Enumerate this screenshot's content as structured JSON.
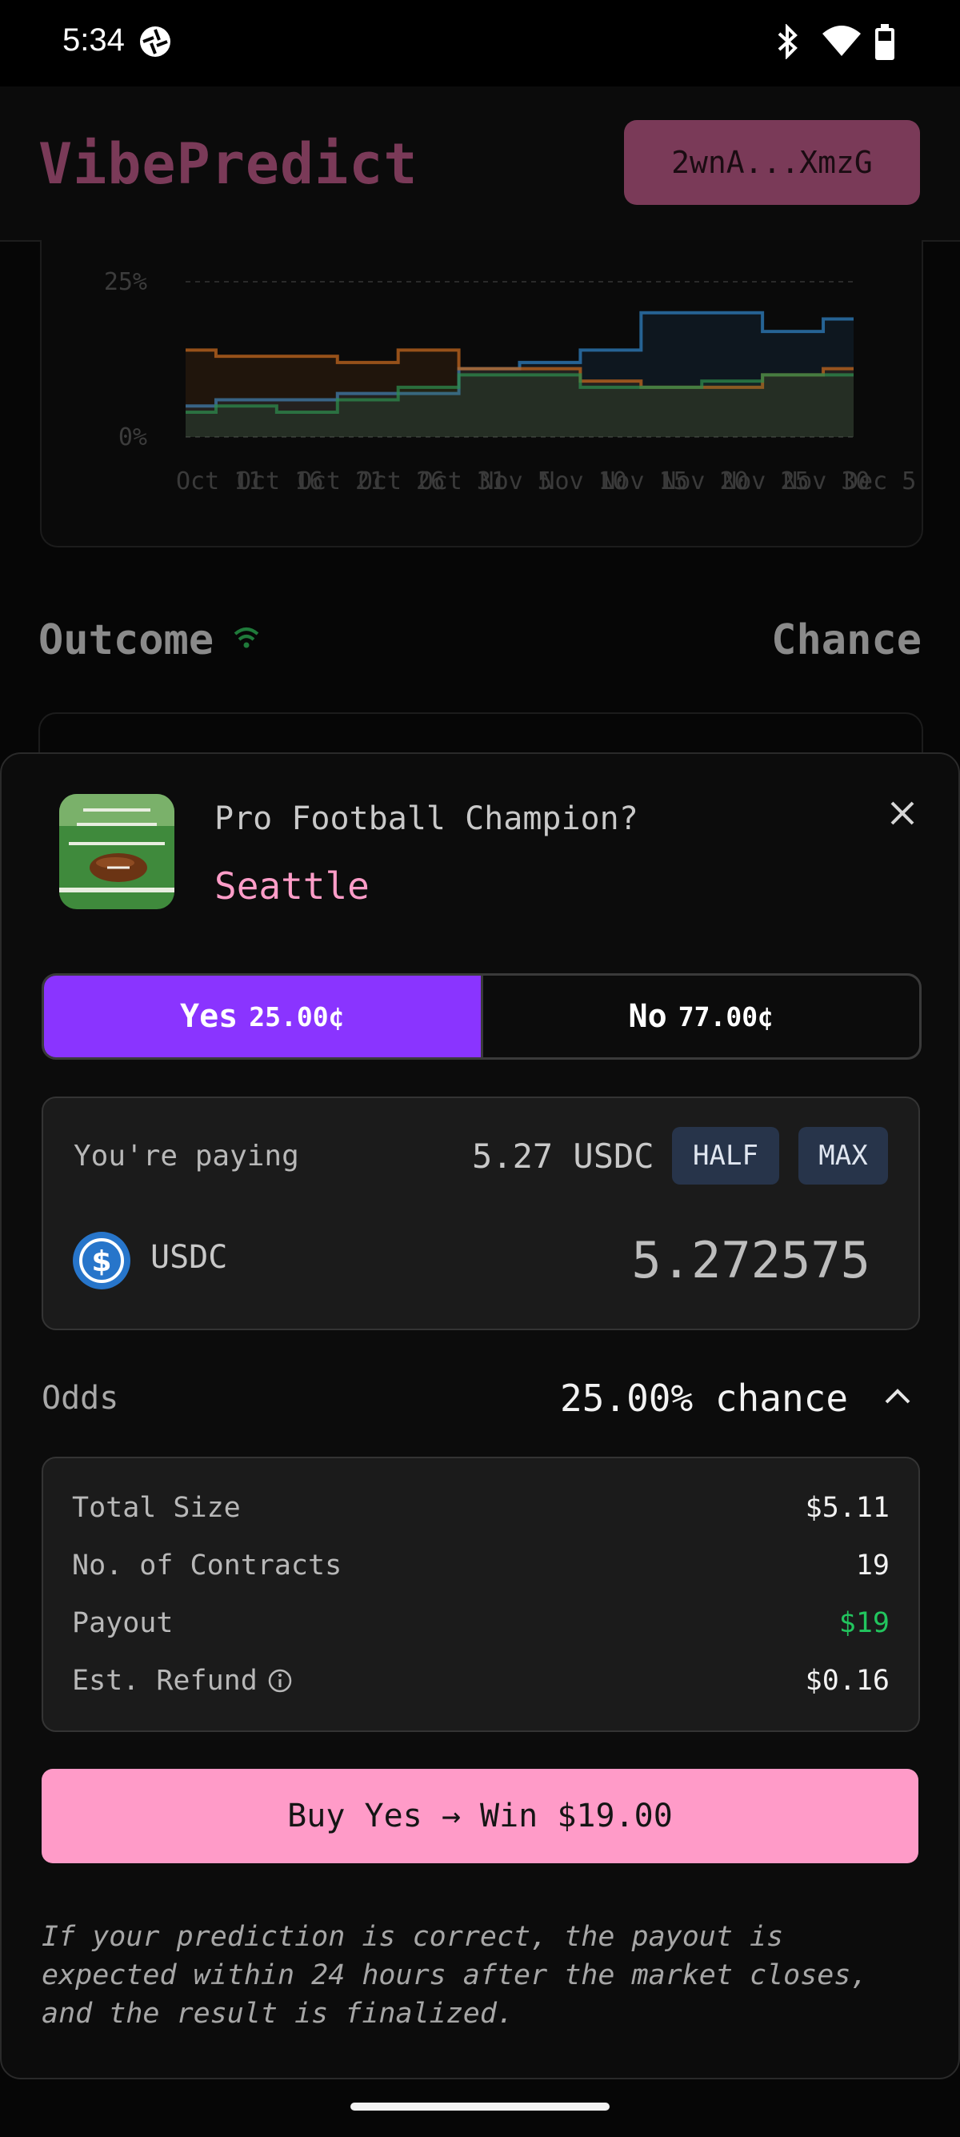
{
  "status_bar": {
    "time": "5:34"
  },
  "header": {
    "brand": "VibePredict",
    "wallet": "2wnA...XmzG"
  },
  "chart_data": {
    "type": "line",
    "x": [
      "Oct 11",
      "Oct 16",
      "Oct 21",
      "Oct 26",
      "Oct 31",
      "Nov 5",
      "Nov 10",
      "Nov 15",
      "Nov 20",
      "Nov 25",
      "Nov 30",
      "Dec 5"
    ],
    "y_ticks": [
      "25%",
      "0%"
    ],
    "ylim": [
      0,
      25
    ],
    "grid": true,
    "series": [
      {
        "color": "#2f7fbf",
        "values": [
          5,
          6,
          6,
          7,
          7,
          11,
          12,
          14,
          20,
          20,
          17,
          19
        ]
      },
      {
        "color": "#c2671f",
        "values": [
          14,
          13,
          13,
          12,
          14,
          11,
          11,
          9,
          8,
          8,
          10,
          11
        ]
      },
      {
        "color": "#2e8a4c",
        "values": [
          4,
          5,
          4,
          6,
          8,
          10,
          10,
          8,
          8,
          9,
          10,
          10
        ]
      }
    ]
  },
  "outcomes_header": {
    "outcome": "Outcome",
    "chance": "Chance"
  },
  "sheet": {
    "question": "Pro Football Champion?",
    "outcome": "Seattle",
    "yes_label": "Yes",
    "yes_price": "25.00¢",
    "no_label": "No",
    "no_price": "77.00¢",
    "paying_label": "You're paying",
    "paying_amount": "5.27 USDC",
    "half": "HALF",
    "max": "MAX",
    "token": "USDC",
    "amount": "5.272575",
    "odds_label": "Odds",
    "odds_value": "25.00% chance",
    "details": [
      {
        "label": "Total Size",
        "value": "$5.11"
      },
      {
        "label": "No. of Contracts",
        "value": "19"
      },
      {
        "label": "Payout",
        "value": "$19"
      },
      {
        "label": "Est. Refund",
        "value": "$0.16"
      }
    ],
    "buy_button": "Buy Yes → Win $19.00",
    "disclaimer": "If your prediction is correct, the payout is expected within 24 hours after the market closes, and the result is finalized."
  },
  "colors": {
    "accent": "#8a34ff",
    "brand": "#ff9bc8",
    "payout": "#22c55e"
  }
}
